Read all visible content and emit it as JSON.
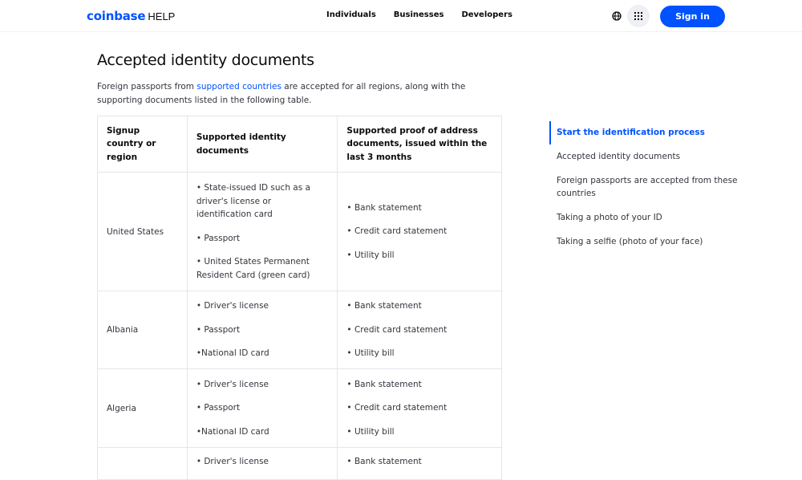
{
  "header": {
    "brand": "coinbase",
    "brand_suffix": "HELP",
    "nav": [
      "Individuals",
      "Businesses",
      "Developers"
    ],
    "signin_label": "Sign in"
  },
  "article": {
    "title": "Accepted identity documents",
    "intro_before": "Foreign passports from ",
    "intro_link": "supported countries",
    "intro_after": " are accepted for all regions, along with the supporting documents listed in the following table."
  },
  "table": {
    "headers": [
      "Signup country or region",
      "Supported identity documents",
      "Supported proof of address documents, issued within the last 3 months"
    ],
    "rows": [
      {
        "country": "United States",
        "identity": [
          "• State-issued ID such as a driver's license or identification card",
          "• Passport",
          "• United States Permanent Resident Card (green card)"
        ],
        "address": [
          "• Bank statement",
          "• Credit card statement",
          "• Utility bill"
        ]
      },
      {
        "country": "Albania",
        "identity": [
          "• Driver's license",
          "• Passport",
          "•National ID card"
        ],
        "address": [
          "• Bank statement",
          "• Credit card statement",
          "• Utility bill"
        ]
      },
      {
        "country": "Algeria",
        "identity": [
          "• Driver's license",
          "• Passport",
          "•National ID card"
        ],
        "address": [
          "• Bank statement",
          "• Credit card statement",
          "• Utility bill"
        ]
      },
      {
        "country": "",
        "identity": [
          "• Driver's license"
        ],
        "address": [
          "• Bank statement"
        ]
      }
    ]
  },
  "toc": {
    "items": [
      "Start the identification process",
      "Accepted identity documents",
      "Foreign passports are accepted from these countries",
      "Taking a photo of your ID",
      "Taking a selfie (photo of your face)"
    ],
    "active_index": 0
  },
  "colors": {
    "brand": "#0052ff",
    "text": "#0a0b0d",
    "border": "#e4e6ea"
  },
  "icons": [
    "globe-icon",
    "apps-grid-icon"
  ]
}
